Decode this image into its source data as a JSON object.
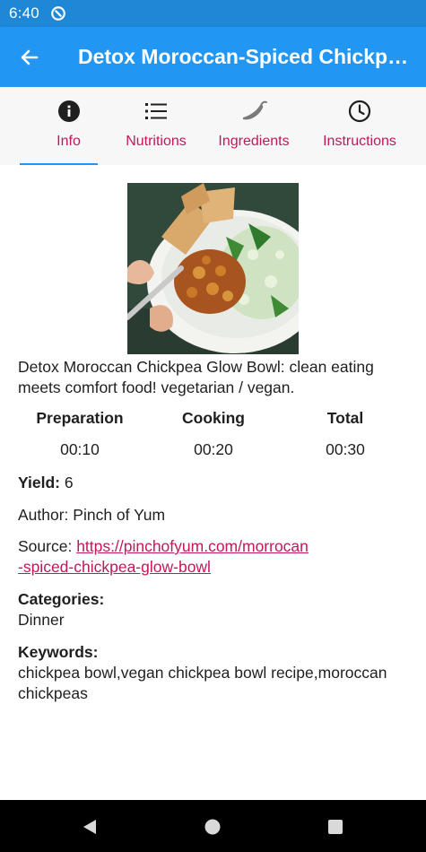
{
  "status_bar": {
    "time": "6:40"
  },
  "app_bar": {
    "title": "Detox Moroccan-Spiced Chickpea Glow Bowl"
  },
  "tabs": [
    {
      "label": "Info",
      "icon": "info-icon",
      "active": true
    },
    {
      "label": "Nutritions",
      "icon": "list-icon",
      "active": false
    },
    {
      "label": "Ingredients",
      "icon": "chili-pepper-icon",
      "active": false
    },
    {
      "label": "Instructions",
      "icon": "clock-icon",
      "active": false
    }
  ],
  "colors": {
    "primary": "#2196f3",
    "status_bar": "#1e88d6",
    "accent": "#c2185b",
    "tab_bg": "#f7f7f7"
  },
  "recipe": {
    "image_icon": "chickpea-bowl-photo",
    "description": "Detox Moroccan Chickpea Glow Bowl: clean eating meets comfort food! vegetarian / vegan.",
    "times": [
      {
        "label": "Preparation",
        "value": "00:10"
      },
      {
        "label": "Cooking",
        "value": "00:20"
      },
      {
        "label": "Total",
        "value": "00:30"
      }
    ],
    "yield_label": "Yield:",
    "yield_value": "6",
    "author": "Author: Pinch of Yum",
    "source_label": "Source:",
    "source_url_line1": "https://pinchofyum.com/morrocan",
    "source_url_line2": "-spiced-chickpea-glow-bowl",
    "categories_label": "Categories:",
    "categories_value": "Dinner",
    "keywords_label": "Keywords:",
    "keywords_value": "chickpea bowl,vegan chickpea bowl recipe,moroccan chickpeas"
  },
  "nav": {
    "back": "back-triangle-icon",
    "home": "home-circle-icon",
    "recents": "recents-square-icon"
  }
}
